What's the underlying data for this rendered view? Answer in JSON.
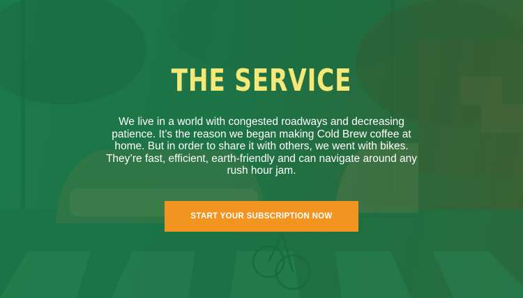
{
  "hero": {
    "title": "THE SERVICE",
    "body": "We live in a world with congested roadways and decreasing patience. It’s the reason we began making Cold Brew coffee at home. But in order to share it with others, we went with bikes. They’re fast, efficient, earth-friendly and can navigate around any rush hour jam.",
    "cta_label": "START YOUR SUBSCRIPTION NOW"
  },
  "colors": {
    "overlay": "#1f7a4a",
    "title": "#f4e978",
    "text": "#ffffff",
    "cta_background": "#f2941f"
  }
}
